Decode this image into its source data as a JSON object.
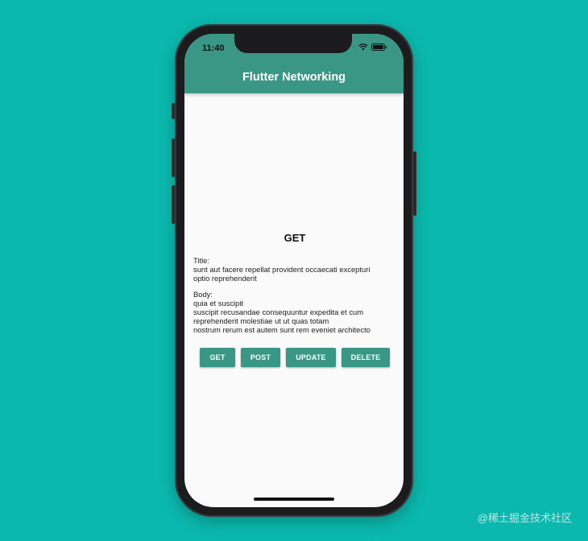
{
  "status_bar": {
    "time": "11:40"
  },
  "app_bar": {
    "title": "Flutter Networking"
  },
  "main": {
    "heading": "GET",
    "title_label": "Title:",
    "title_lines": [
      "sunt aut facere repellat provident occaecati excepturi",
      "optio reprehenderit"
    ],
    "body_label": "Body:",
    "body_lines": [
      "quia et suscipit",
      "suscipit recusandae consequuntur expedita et cum",
      "reprehenderit molestiae ut ut quas totam",
      "nostrum rerum est autem sunt rem eveniet architecto"
    ]
  },
  "buttons": {
    "get": "GET",
    "post": "POST",
    "update": "UPDATE",
    "delete": "DELETE"
  },
  "watermark": "@稀土掘金技术社区",
  "colors": {
    "background": "#0bb8ad",
    "primary": "#3a9685",
    "screen": "#fafafa"
  }
}
